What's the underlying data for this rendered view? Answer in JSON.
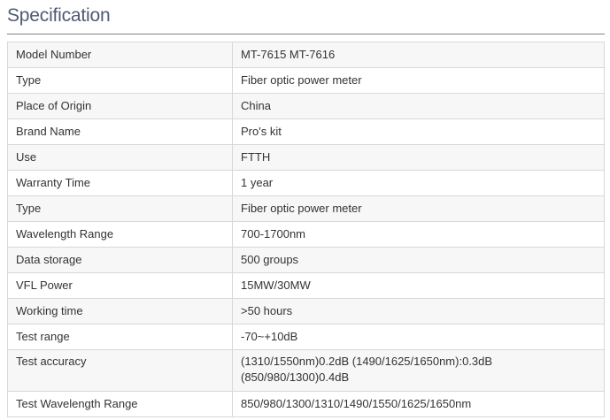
{
  "header": {
    "title": "Specification"
  },
  "spec": {
    "rows": [
      {
        "key": "Model Number",
        "value": "MT-7615 MT-7616"
      },
      {
        "key": "Type",
        "value": "Fiber optic power meter"
      },
      {
        "key": "Place of Origin",
        "value": "China"
      },
      {
        "key": "Brand Name",
        "value": "Pro's kit"
      },
      {
        "key": "Use",
        "value": "FTTH"
      },
      {
        "key": "Warranty Time",
        "value": "1 year"
      },
      {
        "key": "Type",
        "value": "Fiber optic power meter"
      },
      {
        "key": "Wavelength Range",
        "value": "700-1700nm"
      },
      {
        "key": "Data storage",
        "value": "500 groups"
      },
      {
        "key": "VFL Power",
        "value": "15MW/30MW"
      },
      {
        "key": "Working time",
        "value": ">50 hours"
      },
      {
        "key": "Test range",
        "value": "-70~+10dB"
      },
      {
        "key": "Test accuracy",
        "value_line1": "(1310/1550nm)0.2dB (1490/1625/1650nm):0.3dB",
        "value_line2": "(850/980/1300)0.4dB"
      },
      {
        "key": "Test Wavelength Range",
        "value": "850/980/1300/1310/1490/1550/1625/1650nm"
      }
    ]
  }
}
